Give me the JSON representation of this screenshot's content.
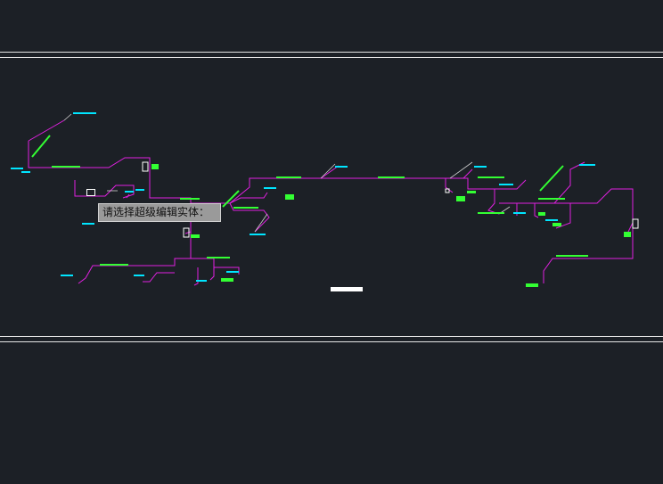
{
  "canvas": {
    "background": "#1c2026",
    "pipe_color": "#e020e0",
    "label_color": "#33ff33",
    "annotation_color": "#00e5ff",
    "border_line_color": "#e6e6e6"
  },
  "command_prompt": {
    "text": "请选择超级编辑实体："
  },
  "cursor": {
    "icon": "pickbox-cursor-icon"
  }
}
